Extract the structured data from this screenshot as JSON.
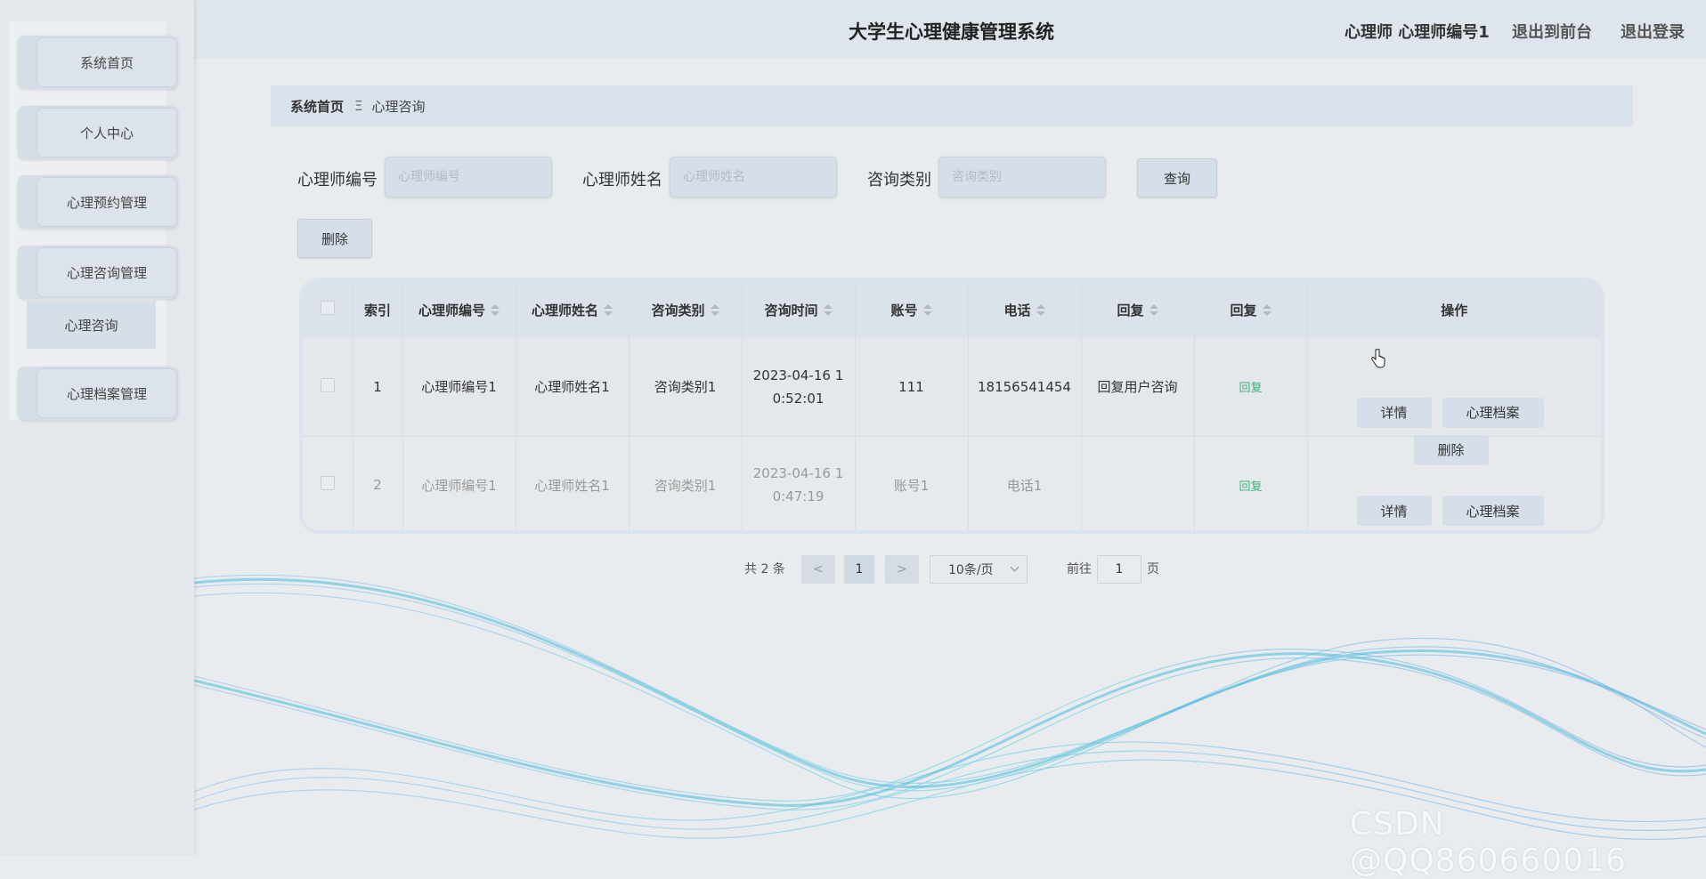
{
  "header": {
    "title": "大学生心理健康管理系统",
    "user": "心理师 心理师编号1",
    "front_link": "退出到前台",
    "logout_link": "退出登录"
  },
  "sidebar": {
    "items": [
      {
        "label": "系统首页"
      },
      {
        "label": "个人中心"
      },
      {
        "label": "心理预约管理"
      },
      {
        "label": "心理咨询管理"
      },
      {
        "label": "心理档案管理"
      }
    ],
    "submenu": {
      "label": "心理咨询"
    }
  },
  "breadcrumb": {
    "home": "系统首页",
    "separator": "Ξ",
    "current": "心理咨询"
  },
  "search": {
    "fields": [
      {
        "label": "心理师编号",
        "placeholder": "心理师编号",
        "value": ""
      },
      {
        "label": "心理师姓名",
        "placeholder": "心理师姓名",
        "value": ""
      },
      {
        "label": "咨询类别",
        "placeholder": "咨询类别",
        "value": ""
      }
    ],
    "query_button": "查询",
    "delete_button": "删除"
  },
  "table": {
    "columns": [
      "索引",
      "心理师编号",
      "心理师姓名",
      "咨询类别",
      "咨询时间",
      "账号",
      "电话",
      "回复",
      "回复",
      "操作"
    ],
    "rows": [
      {
        "index": "1",
        "counselor_no": "心理师编号1",
        "counselor_name": "心理师姓名1",
        "category": "咨询类别1",
        "time_line1": "2023-04-16 1",
        "time_line2": "0:52:01",
        "account": "111",
        "phone": "18156541454",
        "reply": "回复用户咨询",
        "reply_link": "回复"
      },
      {
        "index": "2",
        "counselor_no": "心理师编号1",
        "counselor_name": "心理师姓名1",
        "category": "咨询类别1",
        "time_line1": "2023-04-16 1",
        "time_line2": "0:47:19",
        "account": "账号1",
        "phone": "电话1",
        "reply": "",
        "reply_link": "回复"
      }
    ],
    "row_actions": {
      "detail": "详情",
      "archive": "心理档案",
      "delete": "删除"
    }
  },
  "pagination": {
    "total": "共 2 条",
    "prev": "<",
    "current_page": "1",
    "next": ">",
    "page_size": "10条/页",
    "goto_label": "前往",
    "goto_value": "1",
    "page_suffix": "页"
  },
  "watermark": "CSDN @QQ860660016",
  "colors": {
    "accent": "#3bb27a",
    "panel": "#d5dee9",
    "background": "#e9ecef"
  }
}
